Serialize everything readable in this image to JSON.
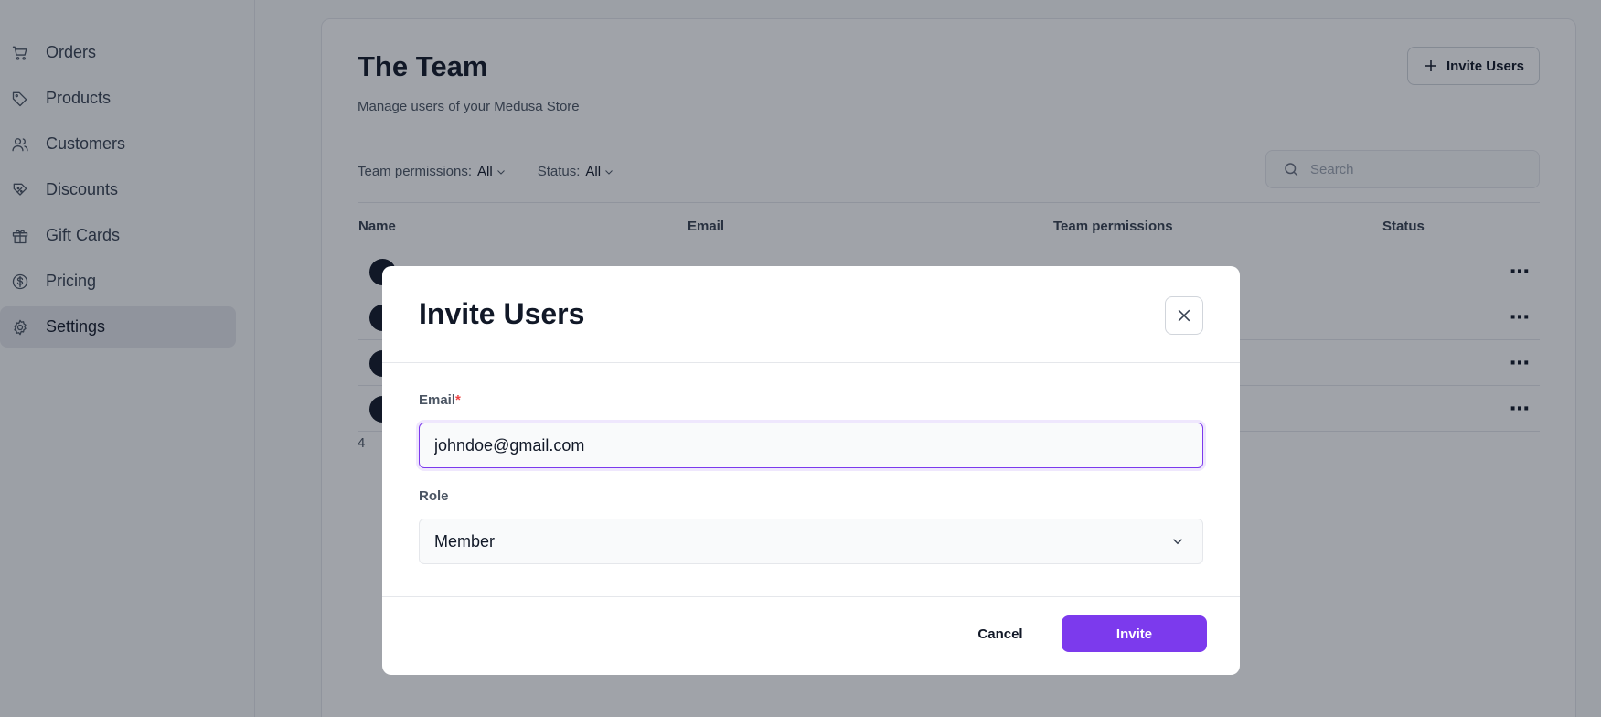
{
  "sidebar": {
    "items": [
      {
        "label": "Orders",
        "icon": "cart-icon"
      },
      {
        "label": "Products",
        "icon": "tag-icon"
      },
      {
        "label": "Customers",
        "icon": "users-icon"
      },
      {
        "label": "Discounts",
        "icon": "discount-icon"
      },
      {
        "label": "Gift Cards",
        "icon": "gift-icon"
      },
      {
        "label": "Pricing",
        "icon": "dollar-icon"
      },
      {
        "label": "Settings",
        "icon": "gear-icon",
        "active": true
      }
    ]
  },
  "page": {
    "title": "The Team",
    "subtitle": "Manage users of your Medusa Store",
    "invite_button": "Invite Users",
    "filters": {
      "permissions_label": "Team permissions:",
      "permissions_value": "All",
      "status_label": "Status:",
      "status_value": "All"
    },
    "search_placeholder": "Search",
    "table": {
      "columns": [
        "Name",
        "Email",
        "Team permissions",
        "Status"
      ],
      "row_count": 4,
      "row_menu": "⋯"
    },
    "count": "4"
  },
  "modal": {
    "title": "Invite Users",
    "email_label": "Email",
    "required_marker": "*",
    "email_value": "johndoe@gmail.com",
    "role_label": "Role",
    "role_value": "Member",
    "cancel_label": "Cancel",
    "invite_label": "Invite"
  },
  "colors": {
    "accent": "#7c3aed",
    "required": "#ef4444",
    "overlay": "rgba(17,24,39,0.40)"
  }
}
